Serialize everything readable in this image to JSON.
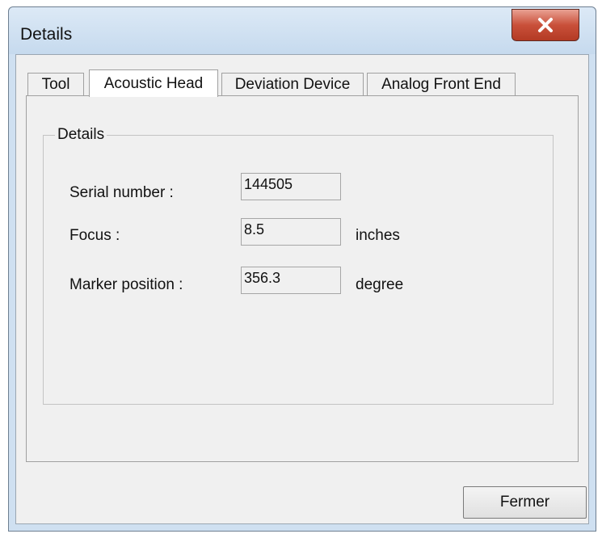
{
  "window": {
    "title": "Details",
    "close_icon": "close-icon"
  },
  "tabs": [
    {
      "label": "Tool",
      "active": false
    },
    {
      "label": "Acoustic Head",
      "active": true
    },
    {
      "label": "Deviation Device",
      "active": false
    },
    {
      "label": "Analog Front End",
      "active": false
    }
  ],
  "group": {
    "label": "Details",
    "fields": [
      {
        "label": "Serial number :",
        "value": "144505",
        "unit": ""
      },
      {
        "label": "Focus :",
        "value": "8.5",
        "unit": "inches"
      },
      {
        "label": "Marker position :",
        "value": "356.3",
        "unit": "degree"
      }
    ]
  },
  "buttons": {
    "close_label": "Fermer"
  },
  "colors": {
    "close_button": "#c9503a",
    "frame": "#cfe0f1"
  }
}
